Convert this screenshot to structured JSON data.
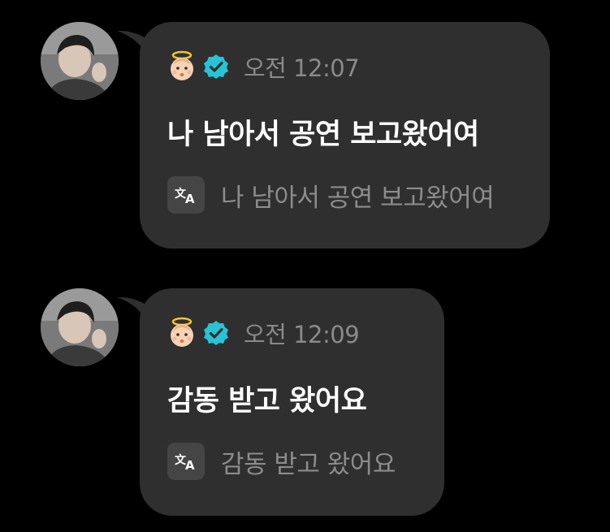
{
  "messages": [
    {
      "author_badge_icon": "angel-baby-emoji",
      "verified_icon": "verified-badge-icon",
      "time": "오전 12:07",
      "text": "나 남아서 공연 보고왔어여",
      "translation_icon": "translate-icon",
      "translated_text": "나 남아서 공연 보고왔어여"
    },
    {
      "author_badge_icon": "angel-baby-emoji",
      "verified_icon": "verified-badge-icon",
      "time": "오전 12:09",
      "text": "감동 받고 왔어요",
      "translation_icon": "translate-icon",
      "translated_text": "감동 받고 왔어요"
    }
  ],
  "colors": {
    "background": "#000000",
    "bubble": "#2f2f2f",
    "verified": "#27c4d6",
    "time": "#8a8a8a",
    "message_text": "#ffffff",
    "translated_text": "#8c8c8c"
  }
}
